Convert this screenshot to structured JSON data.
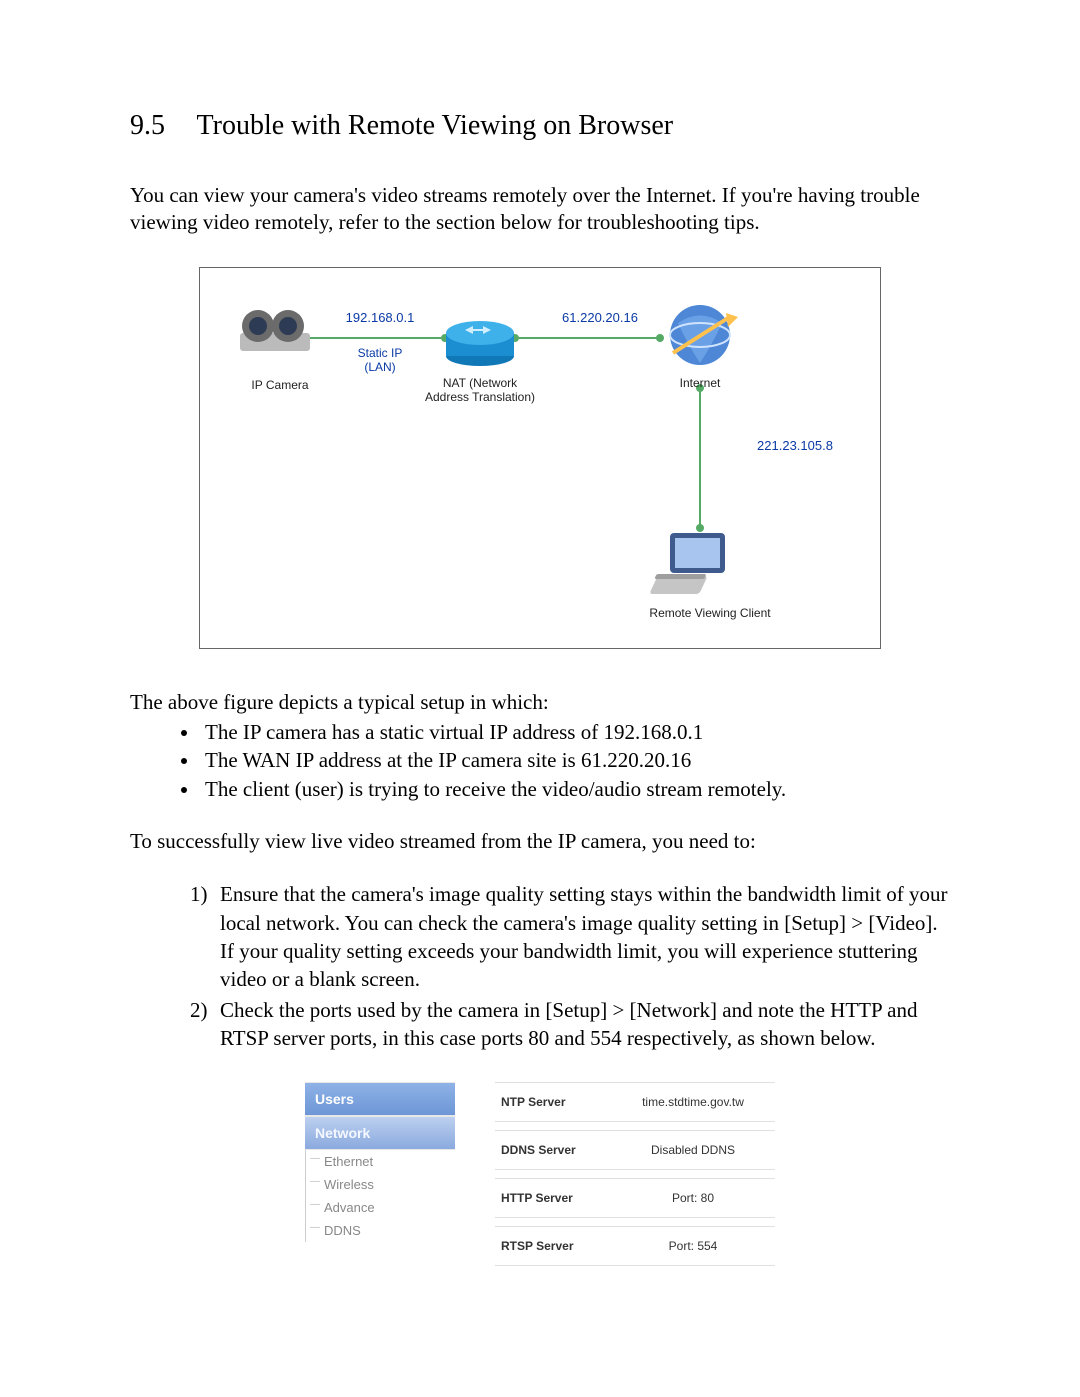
{
  "heading": {
    "number": "9.5",
    "title": "Trouble with Remote Viewing on Browser"
  },
  "intro": "You can view your camera's video streams remotely over the Internet. If you're having trouble viewing video remotely, refer to the section below for troubleshooting tips.",
  "diagram": {
    "ip_camera_label": "IP Camera",
    "static_ip": "192.168.0.1",
    "static_ip_sub": "Static IP\n(LAN)",
    "nat_label": "NAT (Network\nAddress Translation)",
    "wan_ip": "61.220.20.16",
    "internet_label": "Internet",
    "client_ip": "221.23.105.8",
    "client_label": "Remote Viewing Client"
  },
  "after_diagram": "The above figure depicts a typical setup in which:",
  "bullets": [
    "The IP camera has a static virtual IP address of 192.168.0.1",
    "The WAN IP address at the IP camera site is 61.220.20.16",
    "The client (user) is trying to receive the video/audio stream remotely."
  ],
  "pre_steps": "To successfully view live video streamed from the IP camera, you need to:",
  "steps": [
    "Ensure that the camera's image quality setting stays within the bandwidth limit of your local network. You can check the camera's image quality setting in [Setup] > [Video]. If your quality setting exceeds your bandwidth limit, you will experience stuttering video or a blank screen.",
    "Check the ports used by the camera in [Setup] > [Network] and note the HTTP and RTSP server ports, in this case ports 80 and 554 respectively, as shown below."
  ],
  "settings": {
    "nav": {
      "users": "Users",
      "network": "Network",
      "items": [
        "Ethernet",
        "Wireless",
        "Advance",
        "DDNS"
      ]
    },
    "rows": [
      {
        "k": "NTP Server",
        "v": "time.stdtime.gov.tw"
      },
      {
        "k": "DDNS Server",
        "v": "Disabled DDNS"
      },
      {
        "k": "HTTP Server",
        "v": "Port: 80"
      },
      {
        "k": "RTSP Server",
        "v": "Port: 554"
      }
    ]
  }
}
